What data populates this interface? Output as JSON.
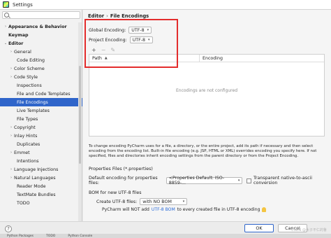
{
  "window": {
    "title": "Settings"
  },
  "search": {
    "placeholder": ""
  },
  "sidebar": {
    "items": [
      {
        "label": "Appearance & Behavior",
        "level": 0,
        "arrow": "›",
        "bold": true
      },
      {
        "label": "Keymap",
        "level": 0,
        "arrow": "",
        "bold": true
      },
      {
        "label": "Editor",
        "level": 0,
        "arrow": "⌄",
        "bold": true
      },
      {
        "label": "General",
        "level": 1,
        "arrow": "›"
      },
      {
        "label": "Code Editing",
        "level": 1,
        "arrow": ""
      },
      {
        "label": "Color Scheme",
        "level": 1,
        "arrow": "›"
      },
      {
        "label": "Code Style",
        "level": 1,
        "arrow": "›"
      },
      {
        "label": "Inspections",
        "level": 1,
        "arrow": ""
      },
      {
        "label": "File and Code Templates",
        "level": 1,
        "arrow": ""
      },
      {
        "label": "File Encodings",
        "level": 1,
        "arrow": "",
        "selected": true
      },
      {
        "label": "Live Templates",
        "level": 1,
        "arrow": ""
      },
      {
        "label": "File Types",
        "level": 1,
        "arrow": ""
      },
      {
        "label": "Copyright",
        "level": 1,
        "arrow": "›"
      },
      {
        "label": "Inlay Hints",
        "level": 1,
        "arrow": "›"
      },
      {
        "label": "Duplicates",
        "level": 1,
        "arrow": ""
      },
      {
        "label": "Emmet",
        "level": 1,
        "arrow": "›"
      },
      {
        "label": "Intentions",
        "level": 1,
        "arrow": ""
      },
      {
        "label": "Language Injections",
        "level": 1,
        "arrow": "›"
      },
      {
        "label": "Natural Languages",
        "level": 1,
        "arrow": "›"
      },
      {
        "label": "Reader Mode",
        "level": 1,
        "arrow": ""
      },
      {
        "label": "TextMate Bundles",
        "level": 1,
        "arrow": ""
      },
      {
        "label": "TODO",
        "level": 1,
        "arrow": ""
      }
    ]
  },
  "breadcrumb": {
    "part1": "Editor",
    "sep": "›",
    "part2": "File Encodings"
  },
  "global_encoding": {
    "label": "Global Encoding:",
    "value": "UTF-8"
  },
  "project_encoding": {
    "label": "Project Encoding:",
    "value": "UTF-8"
  },
  "toolbar": {
    "add": "+",
    "remove": "−",
    "edit": "✎"
  },
  "table": {
    "col_path": "Path",
    "col_encoding": "Encoding",
    "empty_text": "Encodings are not configured"
  },
  "description": "To change encoding PyCharm uses for a file, a directory, or the entire project, add its path if necessary and then select encoding from the encoding list. Built-in file encoding (e.g. JSP, HTML or XML) overrides encoding you specify here. If not specified, files and directories inherit encoding settings from the parent directory or from the Project Encoding.",
  "properties": {
    "section": "Properties Files (*.properties)",
    "default_label": "Default encoding for properties files:",
    "default_value": "<Properties Default: ISO-8859-...",
    "transparent_label": "Transparent native-to-ascii conversion"
  },
  "bom": {
    "section": "BOM for new UTF-8 files",
    "create_label": "Create UTF-8 files:",
    "create_value": "with NO BOM",
    "note_prefix": "PyCharm will NOT add ",
    "note_link": "UTF-8 BOM",
    "note_suffix": " to every created file in UTF-8 encoding"
  },
  "buttons": {
    "ok": "OK",
    "cancel": "Cancel",
    "help": "?"
  },
  "statusbar": {
    "items": [
      "Python Packages",
      "TODO",
      "Python Console"
    ]
  },
  "watermark": "CSDN @太子不仁的鲁",
  "colors": {
    "selection": "#2f65ca",
    "highlight_box": "#e32c2c",
    "link": "#2a6bd8"
  }
}
